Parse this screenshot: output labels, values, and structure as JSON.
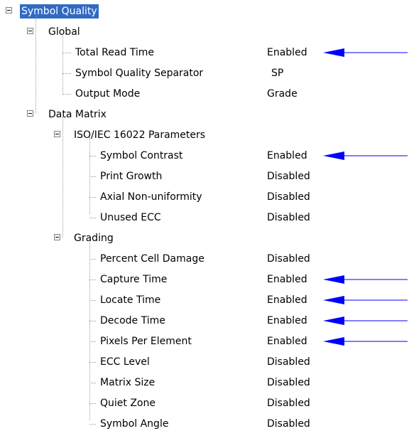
{
  "tree": {
    "root": "Symbol Quality",
    "global": {
      "label": "Global",
      "items": [
        {
          "label": "Total Read Time",
          "value": "Enabled",
          "arrow": true
        },
        {
          "label": "Symbol Quality Separator",
          "value": "SP",
          "arrow": false
        },
        {
          "label": "Output Mode",
          "value": "Grade",
          "arrow": false
        }
      ]
    },
    "data_matrix": {
      "label": "Data Matrix",
      "iso": {
        "label": "ISO/IEC 16022 Parameters",
        "items": [
          {
            "label": "Symbol Contrast",
            "value": "Enabled",
            "arrow": true
          },
          {
            "label": "Print Growth",
            "value": "Disabled",
            "arrow": false
          },
          {
            "label": "Axial Non-uniformity",
            "value": "Disabled",
            "arrow": false
          },
          {
            "label": "Unused ECC",
            "value": "Disabled",
            "arrow": false
          }
        ]
      },
      "grading": {
        "label": "Grading",
        "items": [
          {
            "label": "Percent Cell Damage",
            "value": "Disabled",
            "arrow": false
          },
          {
            "label": "Capture Time",
            "value": "Enabled",
            "arrow": true
          },
          {
            "label": "Locate Time",
            "value": "Enabled",
            "arrow": true
          },
          {
            "label": "Decode Time",
            "value": "Enabled",
            "arrow": true
          },
          {
            "label": "Pixels Per Element",
            "value": "Enabled",
            "arrow": true
          },
          {
            "label": "ECC Level",
            "value": "Disabled",
            "arrow": false
          },
          {
            "label": "Matrix Size",
            "value": "Disabled",
            "arrow": false
          },
          {
            "label": "Quiet Zone",
            "value": "Disabled",
            "arrow": false
          },
          {
            "label": "Symbol Angle",
            "value": "Disabled",
            "arrow": false
          }
        ]
      }
    }
  },
  "colors": {
    "selection": "#316ac5",
    "arrow": "#0000ff"
  },
  "icons": {
    "expander": "minus-box-icon",
    "callout": "arrow-left-icon"
  }
}
